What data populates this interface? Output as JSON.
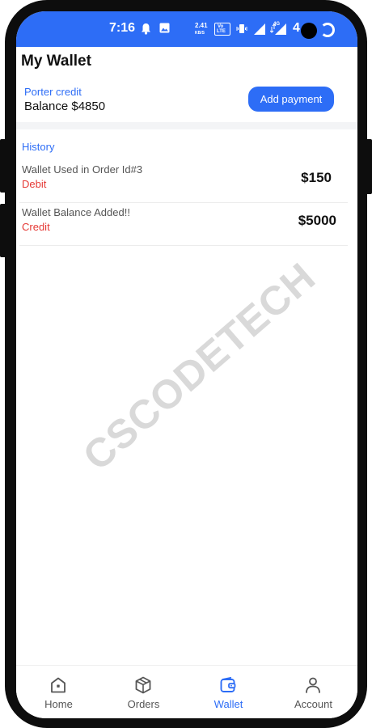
{
  "status_bar": {
    "time": "7:16",
    "speed_value": "2.41",
    "speed_unit": "KB/S",
    "volte_top": "Vo",
    "volte_bottom": "LTE",
    "network_label": "4G",
    "battery": "4",
    "icons": [
      "bell-icon",
      "image-icon",
      "volte-icon",
      "vibrate-icon",
      "signal-icon",
      "signal-4g-icon",
      "camera-cutout",
      "battery-ring-icon"
    ]
  },
  "page": {
    "title": "My Wallet",
    "credit_label": "Porter credit",
    "balance_text": "Balance $4850",
    "add_payment_label": "Add payment"
  },
  "history": {
    "label": "History",
    "items": [
      {
        "description": "Wallet Used in Order Id#3",
        "type": "Debit",
        "amount": "$150"
      },
      {
        "description": "Wallet Balance Added!!",
        "type": "Credit",
        "amount": "$5000"
      }
    ]
  },
  "watermark": "CSCODETECH",
  "nav": {
    "items": [
      {
        "label": "Home",
        "icon": "home-icon",
        "active": false
      },
      {
        "label": "Orders",
        "icon": "box-icon",
        "active": false
      },
      {
        "label": "Wallet",
        "icon": "wallet-icon",
        "active": true
      },
      {
        "label": "Account",
        "icon": "person-icon",
        "active": false
      }
    ]
  },
  "colors": {
    "accent": "#2d6df6",
    "debit_credit": "#e53935",
    "frame": "#0d0d0d"
  }
}
